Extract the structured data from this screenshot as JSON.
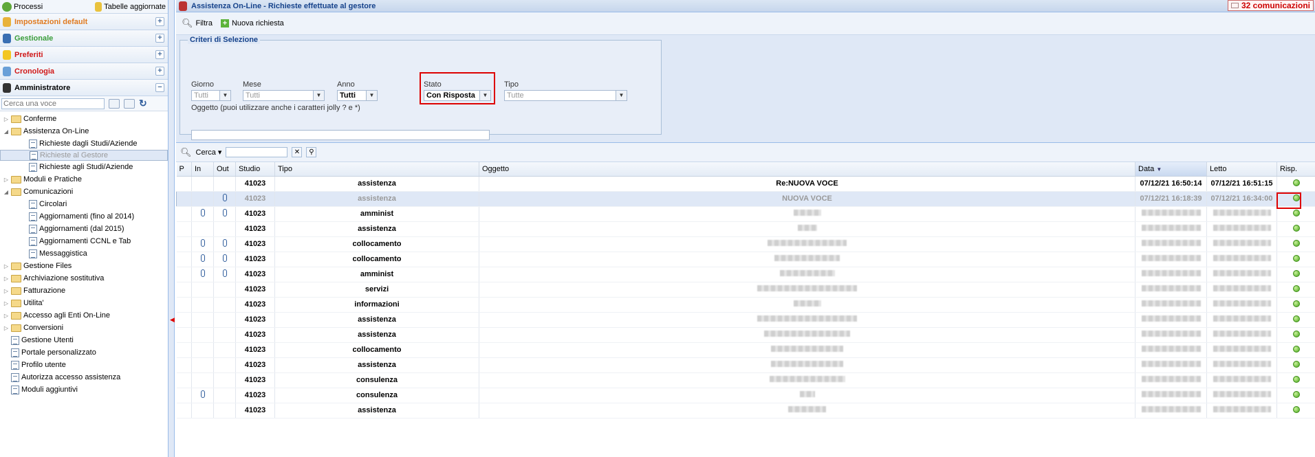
{
  "left": {
    "top": {
      "processi": "Processi",
      "tabelle": "Tabelle aggiornate"
    },
    "accordion": [
      {
        "label": "Impostazioni default",
        "color": "#e07a1f",
        "sign": "+"
      },
      {
        "label": "Gestionale",
        "color": "#3a9d3a",
        "sign": "+"
      },
      {
        "label": "Preferiti",
        "color": "#d01818",
        "sign": "+"
      },
      {
        "label": "Cronologia",
        "color": "#d01818",
        "sign": "+"
      },
      {
        "label": "Amministratore",
        "color": "#000000",
        "sign": "−"
      }
    ],
    "search_placeholder": "Cerca una voce",
    "tree": [
      {
        "label": "Conferme",
        "type": "folder",
        "lvl": 0,
        "tog": "▷"
      },
      {
        "label": "Assistenza On-Line",
        "type": "folder",
        "lvl": 0,
        "tog": "◢"
      },
      {
        "label": "Richieste dagli Studi/Aziende",
        "type": "page",
        "lvl": 1,
        "tog": ""
      },
      {
        "label": "Richieste al Gestore",
        "type": "page",
        "lvl": 1,
        "tog": "",
        "selected": true
      },
      {
        "label": "Richieste agli Studi/Aziende",
        "type": "page",
        "lvl": 1,
        "tog": ""
      },
      {
        "label": "Moduli e Pratiche",
        "type": "folder",
        "lvl": 0,
        "tog": "▷"
      },
      {
        "label": "Comunicazioni",
        "type": "folder",
        "lvl": 0,
        "tog": "◢"
      },
      {
        "label": "Circolari",
        "type": "page",
        "lvl": 1,
        "tog": ""
      },
      {
        "label": "Aggiornamenti (fino al 2014)",
        "type": "page",
        "lvl": 1,
        "tog": ""
      },
      {
        "label": "Aggiornamenti (dal 2015)",
        "type": "page",
        "lvl": 1,
        "tog": ""
      },
      {
        "label": "Aggiornamenti CCNL e Tab",
        "type": "page",
        "lvl": 1,
        "tog": ""
      },
      {
        "label": "Messaggistica",
        "type": "page",
        "lvl": 1,
        "tog": ""
      },
      {
        "label": "Gestione Files",
        "type": "folder",
        "lvl": 0,
        "tog": "▷"
      },
      {
        "label": "Archiviazione sostitutiva",
        "type": "folder",
        "lvl": 0,
        "tog": "▷"
      },
      {
        "label": "Fatturazione",
        "type": "folder",
        "lvl": 0,
        "tog": "▷"
      },
      {
        "label": "Utilita'",
        "type": "folder",
        "lvl": 0,
        "tog": "▷"
      },
      {
        "label": "Accesso agli Enti On-Line",
        "type": "folder",
        "lvl": 0,
        "tog": "▷"
      },
      {
        "label": "Conversioni",
        "type": "folder",
        "lvl": 0,
        "tog": "▷"
      },
      {
        "label": "Gestione Utenti",
        "type": "page",
        "lvl": 0,
        "tog": ""
      },
      {
        "label": "Portale personalizzato",
        "type": "page",
        "lvl": 0,
        "tog": ""
      },
      {
        "label": "Profilo utente",
        "type": "page",
        "lvl": 0,
        "tog": ""
      },
      {
        "label": "Autorizza accesso assistenza",
        "type": "page",
        "lvl": 0,
        "tog": ""
      },
      {
        "label": "Moduli aggiuntivi",
        "type": "page",
        "lvl": 0,
        "tog": ""
      }
    ]
  },
  "main": {
    "title": "Assistenza On-Line - Richieste effettuate al gestore",
    "comms": "32 comunicazioni",
    "toolbar": {
      "filtra": "Filtra",
      "nuova": "Nuova richiesta"
    },
    "criteria": {
      "title": "Criteri di Selezione",
      "giorno": {
        "label": "Giorno",
        "value": "Tutti"
      },
      "mese": {
        "label": "Mese",
        "value": "Tutti"
      },
      "anno": {
        "label": "Anno",
        "value": "Tutti"
      },
      "stato": {
        "label": "Stato",
        "value": "Con Risposta"
      },
      "tipo": {
        "label": "Tipo",
        "value": "Tutte"
      },
      "oggetto_label": "Oggetto (puoi utilizzare anche i caratteri jolly ? e *)"
    },
    "grid_search": {
      "label": "Cerca",
      "clear": "✕"
    },
    "columns": [
      "P",
      "In",
      "Out",
      "Studio",
      "Tipo",
      "Oggetto",
      "Data",
      "Letto",
      "Risp."
    ],
    "rows": [
      {
        "in": false,
        "out": false,
        "studio": "41023",
        "tipo": "assistenza",
        "oggetto": "Re:NUOVA VOCE",
        "data": "07/12/21 16:50:14",
        "letto": "07/12/21 16:51:15"
      },
      {
        "in": false,
        "out": true,
        "studio": "41023",
        "tipo": "assistenza",
        "oggetto": "NUOVA VOCE",
        "data": "07/12/21 16:18:39",
        "letto": "07/12/21 16:34:00",
        "selected": true
      },
      {
        "in": true,
        "out": true,
        "studio": "41023",
        "tipo": "amminist",
        "oggetto": "",
        "data": "",
        "letto": ""
      },
      {
        "in": false,
        "out": false,
        "studio": "41023",
        "tipo": "assistenza",
        "oggetto": "",
        "data": "",
        "letto": ""
      },
      {
        "in": true,
        "out": true,
        "studio": "41023",
        "tipo": "collocamento",
        "oggetto": "",
        "data": "",
        "letto": ""
      },
      {
        "in": true,
        "out": true,
        "studio": "41023",
        "tipo": "collocamento",
        "oggetto": "",
        "data": "",
        "letto": ""
      },
      {
        "in": true,
        "out": true,
        "studio": "41023",
        "tipo": "amminist",
        "oggetto": "",
        "data": "",
        "letto": ""
      },
      {
        "in": false,
        "out": false,
        "studio": "41023",
        "tipo": "servizi",
        "oggetto": "",
        "data": "",
        "letto": ""
      },
      {
        "in": false,
        "out": false,
        "studio": "41023",
        "tipo": "informazioni",
        "oggetto": "",
        "data": "",
        "letto": ""
      },
      {
        "in": false,
        "out": false,
        "studio": "41023",
        "tipo": "assistenza",
        "oggetto": "",
        "data": "",
        "letto": ""
      },
      {
        "in": false,
        "out": false,
        "studio": "41023",
        "tipo": "assistenza",
        "oggetto": "",
        "data": "",
        "letto": ""
      },
      {
        "in": false,
        "out": false,
        "studio": "41023",
        "tipo": "collocamento",
        "oggetto": "",
        "data": "",
        "letto": ""
      },
      {
        "in": false,
        "out": false,
        "studio": "41023",
        "tipo": "assistenza",
        "oggetto": "",
        "data": "",
        "letto": ""
      },
      {
        "in": false,
        "out": false,
        "studio": "41023",
        "tipo": "consulenza",
        "oggetto": "",
        "data": "",
        "letto": ""
      },
      {
        "in": true,
        "out": false,
        "studio": "41023",
        "tipo": "consulenza",
        "oggetto": "",
        "data": "",
        "letto": ""
      },
      {
        "in": false,
        "out": false,
        "studio": "41023",
        "tipo": "assistenza",
        "oggetto": "",
        "data": "",
        "letto": ""
      }
    ]
  }
}
